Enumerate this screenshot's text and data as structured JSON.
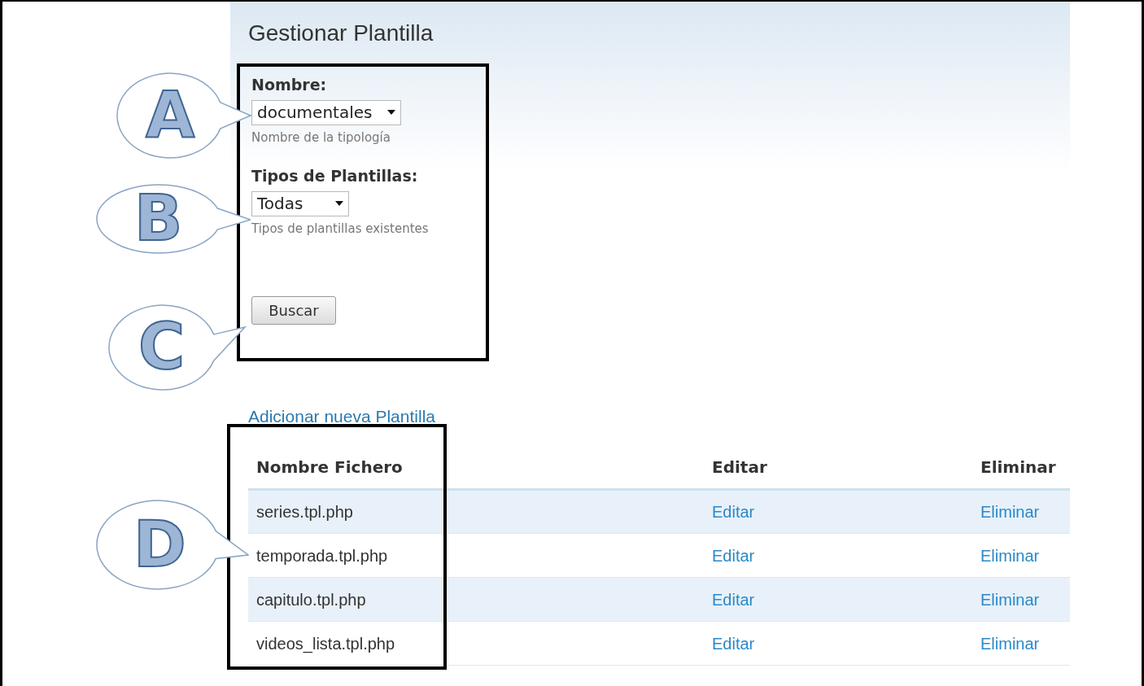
{
  "page": {
    "title": "Gestionar Plantilla"
  },
  "form": {
    "fields": [
      {
        "label": "Nombre:",
        "value": "documentales",
        "hint": "Nombre de la tipología"
      },
      {
        "label": "Tipos de Plantillas:",
        "value": "Todas",
        "hint": "Tipos de plantillas existentes"
      }
    ],
    "button": "Buscar"
  },
  "add_link": "Adicionar nueva Plantilla",
  "table": {
    "columns": [
      "Nombre Fichero",
      "Editar",
      "Eliminar"
    ],
    "rows": [
      {
        "file": "series.tpl.php",
        "edit": "Editar",
        "delete": "Eliminar"
      },
      {
        "file": "temporada.tpl.php",
        "edit": "Editar",
        "delete": "Eliminar"
      },
      {
        "file": "capitulo.tpl.php",
        "edit": "Editar",
        "delete": "Eliminar"
      },
      {
        "file": "videos_lista.tpl.php",
        "edit": "Editar",
        "delete": "Eliminar"
      }
    ]
  },
  "callouts": [
    {
      "letter": "A"
    },
    {
      "letter": "B"
    },
    {
      "letter": "C"
    },
    {
      "letter": "D"
    }
  ]
}
